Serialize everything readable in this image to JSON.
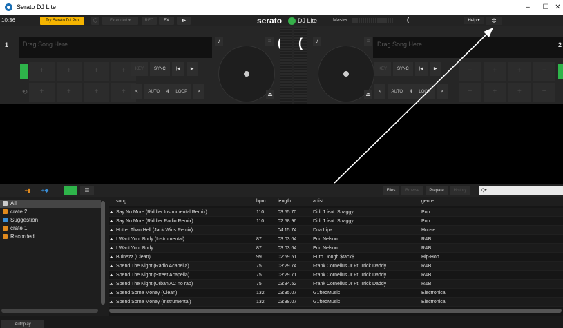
{
  "window": {
    "title": "Serato DJ Lite",
    "minimize": "–",
    "maximize": "☐",
    "close": "✕"
  },
  "topbar": {
    "time": "10:36",
    "try_pro": "Try Serato DJ Pro",
    "extended": "Extended ▾",
    "rec": "REC",
    "fx": "FX",
    "brand": "serato",
    "brand_sub": "DJ Lite",
    "master": "Master",
    "help": "Help ▾",
    "gear_icon": "gear-icon"
  },
  "decks": [
    {
      "number": "1",
      "song_placeholder": "Drag Song Here",
      "sync": "SYNC",
      "auto": "AUTO",
      "loop_size": "4",
      "loop": "LOOP"
    },
    {
      "number": "2",
      "song_placeholder": "Drag Song Here",
      "sync": "SYNC",
      "auto": "AUTO",
      "loop_size": "4",
      "loop": "LOOP"
    }
  ],
  "library_toolbar": {
    "files": "Files",
    "browse": "Browse",
    "prepare": "Prepare",
    "history": "History",
    "search_placeholder": "Q▾"
  },
  "crates": [
    {
      "label": "All",
      "color": "#cccccc",
      "selected": true
    },
    {
      "label": "crate 2",
      "color": "#e08a1e",
      "selected": false
    },
    {
      "label": "Suggestion",
      "color": "#3a8fd8",
      "selected": false
    },
    {
      "label": "crate 1",
      "color": "#e08a1e",
      "selected": false
    },
    {
      "label": "Recorded",
      "color": "#e08a1e",
      "selected": false
    }
  ],
  "table": {
    "columns": [
      "song",
      "bpm",
      "length",
      "artist",
      "genre"
    ],
    "rows": [
      [
        "Say No More (Riddler Instrumental Remix)",
        "110",
        "03:55.70",
        "Didi J feat. Shaggy",
        "Pop"
      ],
      [
        "Say No More (Riddler Radio Remix)",
        "110",
        "02:58.96",
        "Didi J feat. Shaggy",
        "Pop"
      ],
      [
        "Hotter Than Hell (Jack Wins Remix)",
        "",
        "04:15.74",
        "Dua Lipa",
        "House"
      ],
      [
        "I Want Your Body (Instrumental)",
        "87",
        "03:03.64",
        "Eric Nelson",
        "R&B"
      ],
      [
        "I Want Your Body",
        "87",
        "03:03.64",
        "Eric Nelson",
        "R&B"
      ],
      [
        "Buinezz (Clean)",
        "99",
        "02:59.51",
        "Euro Dough $tack$",
        "Hip-Hop"
      ],
      [
        "Spend The Night (Radio Acapella)",
        "75",
        "03:29.74",
        "Frank Cornelius Jr Ft. Trick Daddy",
        "R&B"
      ],
      [
        "Spend The Night (Street Acapella)",
        "75",
        "03:29.71",
        "Frank Cornelius Jr Ft. Trick Daddy",
        "R&B"
      ],
      [
        "Spend The Night (Urban AC no rap)",
        "75",
        "03:34.52",
        "Frank Cornelius Jr Ft. Trick Daddy",
        "R&B"
      ],
      [
        "Spend Some Money (Clean)",
        "132",
        "03:35.07",
        "G1ftedMusic",
        "Electronica"
      ],
      [
        "Spend Some Money (Instrumental)",
        "132",
        "03:38.07",
        "G1ftedMusic",
        "Electronica"
      ]
    ]
  },
  "bottom": {
    "autoplay": "Autoplay"
  },
  "colors": {
    "accent_pro": "#f5b400",
    "cue_green": "#2eb44a",
    "annotation": "#ffffff"
  }
}
